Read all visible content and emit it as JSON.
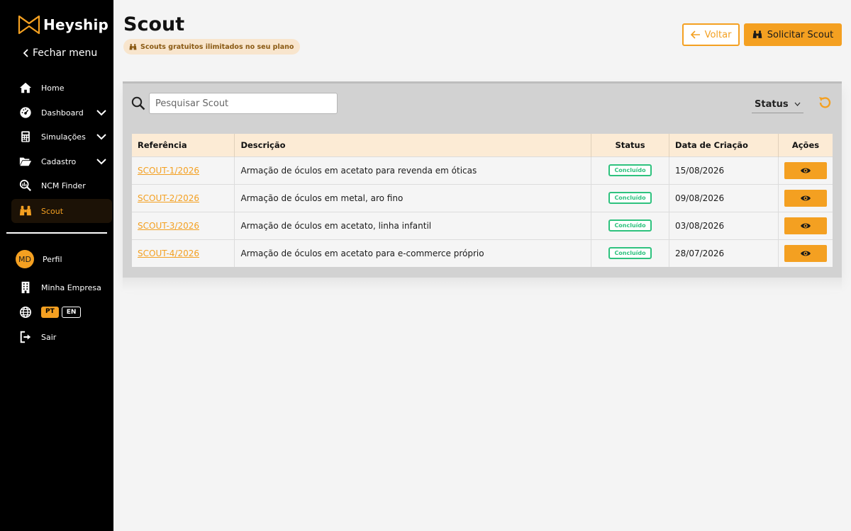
{
  "brand": {
    "name": "Heyship",
    "accent": "#f4a021"
  },
  "sidebar": {
    "close_label": "Fechar menu",
    "items": [
      {
        "label": "Home",
        "icon": "home-icon"
      },
      {
        "label": "Dashboard",
        "icon": "dashboard-icon",
        "expandable": true
      },
      {
        "label": "Simulações",
        "icon": "calculator-icon",
        "expandable": true
      },
      {
        "label": "Cadastro",
        "icon": "folder-icon",
        "expandable": true
      },
      {
        "label": "NCM Finder",
        "icon": "ncm-search-icon"
      },
      {
        "label": "Scout",
        "icon": "binoculars-icon",
        "active": true
      }
    ],
    "profile": {
      "initials": "MD",
      "label": "Perfil"
    },
    "company_label": "Minha Empresa",
    "languages": {
      "pt": "PT",
      "en": "EN",
      "selected": "PT"
    },
    "logout_label": "Sair"
  },
  "header": {
    "title": "Scout",
    "badge": "Scouts gratuitos ilimitados no seu plano",
    "back_label": "Voltar",
    "request_label": "Solicitar Scout"
  },
  "filters": {
    "search_placeholder": "Pesquisar Scout",
    "status_label": "Status"
  },
  "table": {
    "columns": [
      "Referência",
      "Descrição",
      "Status",
      "Data de Criação",
      "Ações"
    ],
    "rows": [
      {
        "ref": "SCOUT-1/2026",
        "desc": "Armação de óculos em acetato para revenda em óticas",
        "status": "Concluído",
        "date": "15/08/2026"
      },
      {
        "ref": "SCOUT-2/2026",
        "desc": "Armação de óculos em metal, aro fino",
        "status": "Concluído",
        "date": "09/08/2026"
      },
      {
        "ref": "SCOUT-3/2026",
        "desc": "Armação de óculos em acetato, linha infantil",
        "status": "Concluído",
        "date": "03/08/2026"
      },
      {
        "ref": "SCOUT-4/2026",
        "desc": "Armação de óculos em acetato para e-commerce próprio",
        "status": "Concluído",
        "date": "28/07/2026"
      }
    ]
  }
}
